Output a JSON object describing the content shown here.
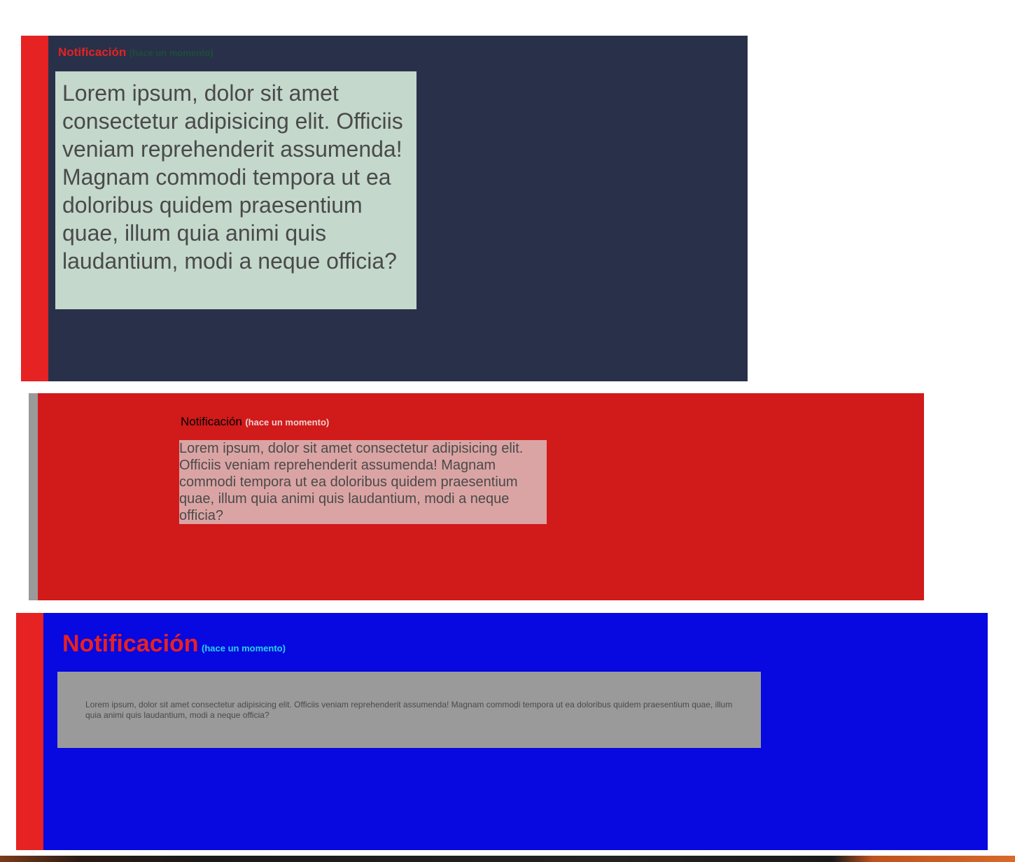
{
  "notifications": [
    {
      "title": "Notificación",
      "time": "(hace un momento)",
      "message": "Lorem ipsum, dolor sit amet consectetur adipisicing elit. Officiis veniam reprehenderit assumenda! Magnam commodi tempora ut ea doloribus quidem praesentium quae, illum quia animi quis laudantium, modi a neque officia?",
      "colors": {
        "background": "#283149",
        "accent": "#e62222",
        "message_background": "#c4d8cc"
      }
    },
    {
      "title": "Notificación",
      "time": "(hace un momento)",
      "message": "Lorem ipsum, dolor sit amet consectetur adipisicing elit. Officiis veniam reprehenderit assumenda! Magnam commodi tempora ut ea doloribus quidem praesentium quae, illum quia animi quis laudantium, modi a neque officia?",
      "colors": {
        "background": "#d11a1a",
        "accent": "#9a9a9a",
        "message_background": "#dba4a4"
      }
    },
    {
      "title": "Notificación",
      "time": "(hace un momento)",
      "message": "Lorem ipsum, dolor sit amet consectetur adipisicing elit. Officiis veniam reprehenderit assumenda! Magnam commodi tempora ut ea doloribus quidem praesentium quae, illum quia animi quis laudantium, modi a neque officia?",
      "colors": {
        "background": "#0808e0",
        "accent": "#e62222",
        "message_background": "#9a9a9a"
      }
    }
  ]
}
